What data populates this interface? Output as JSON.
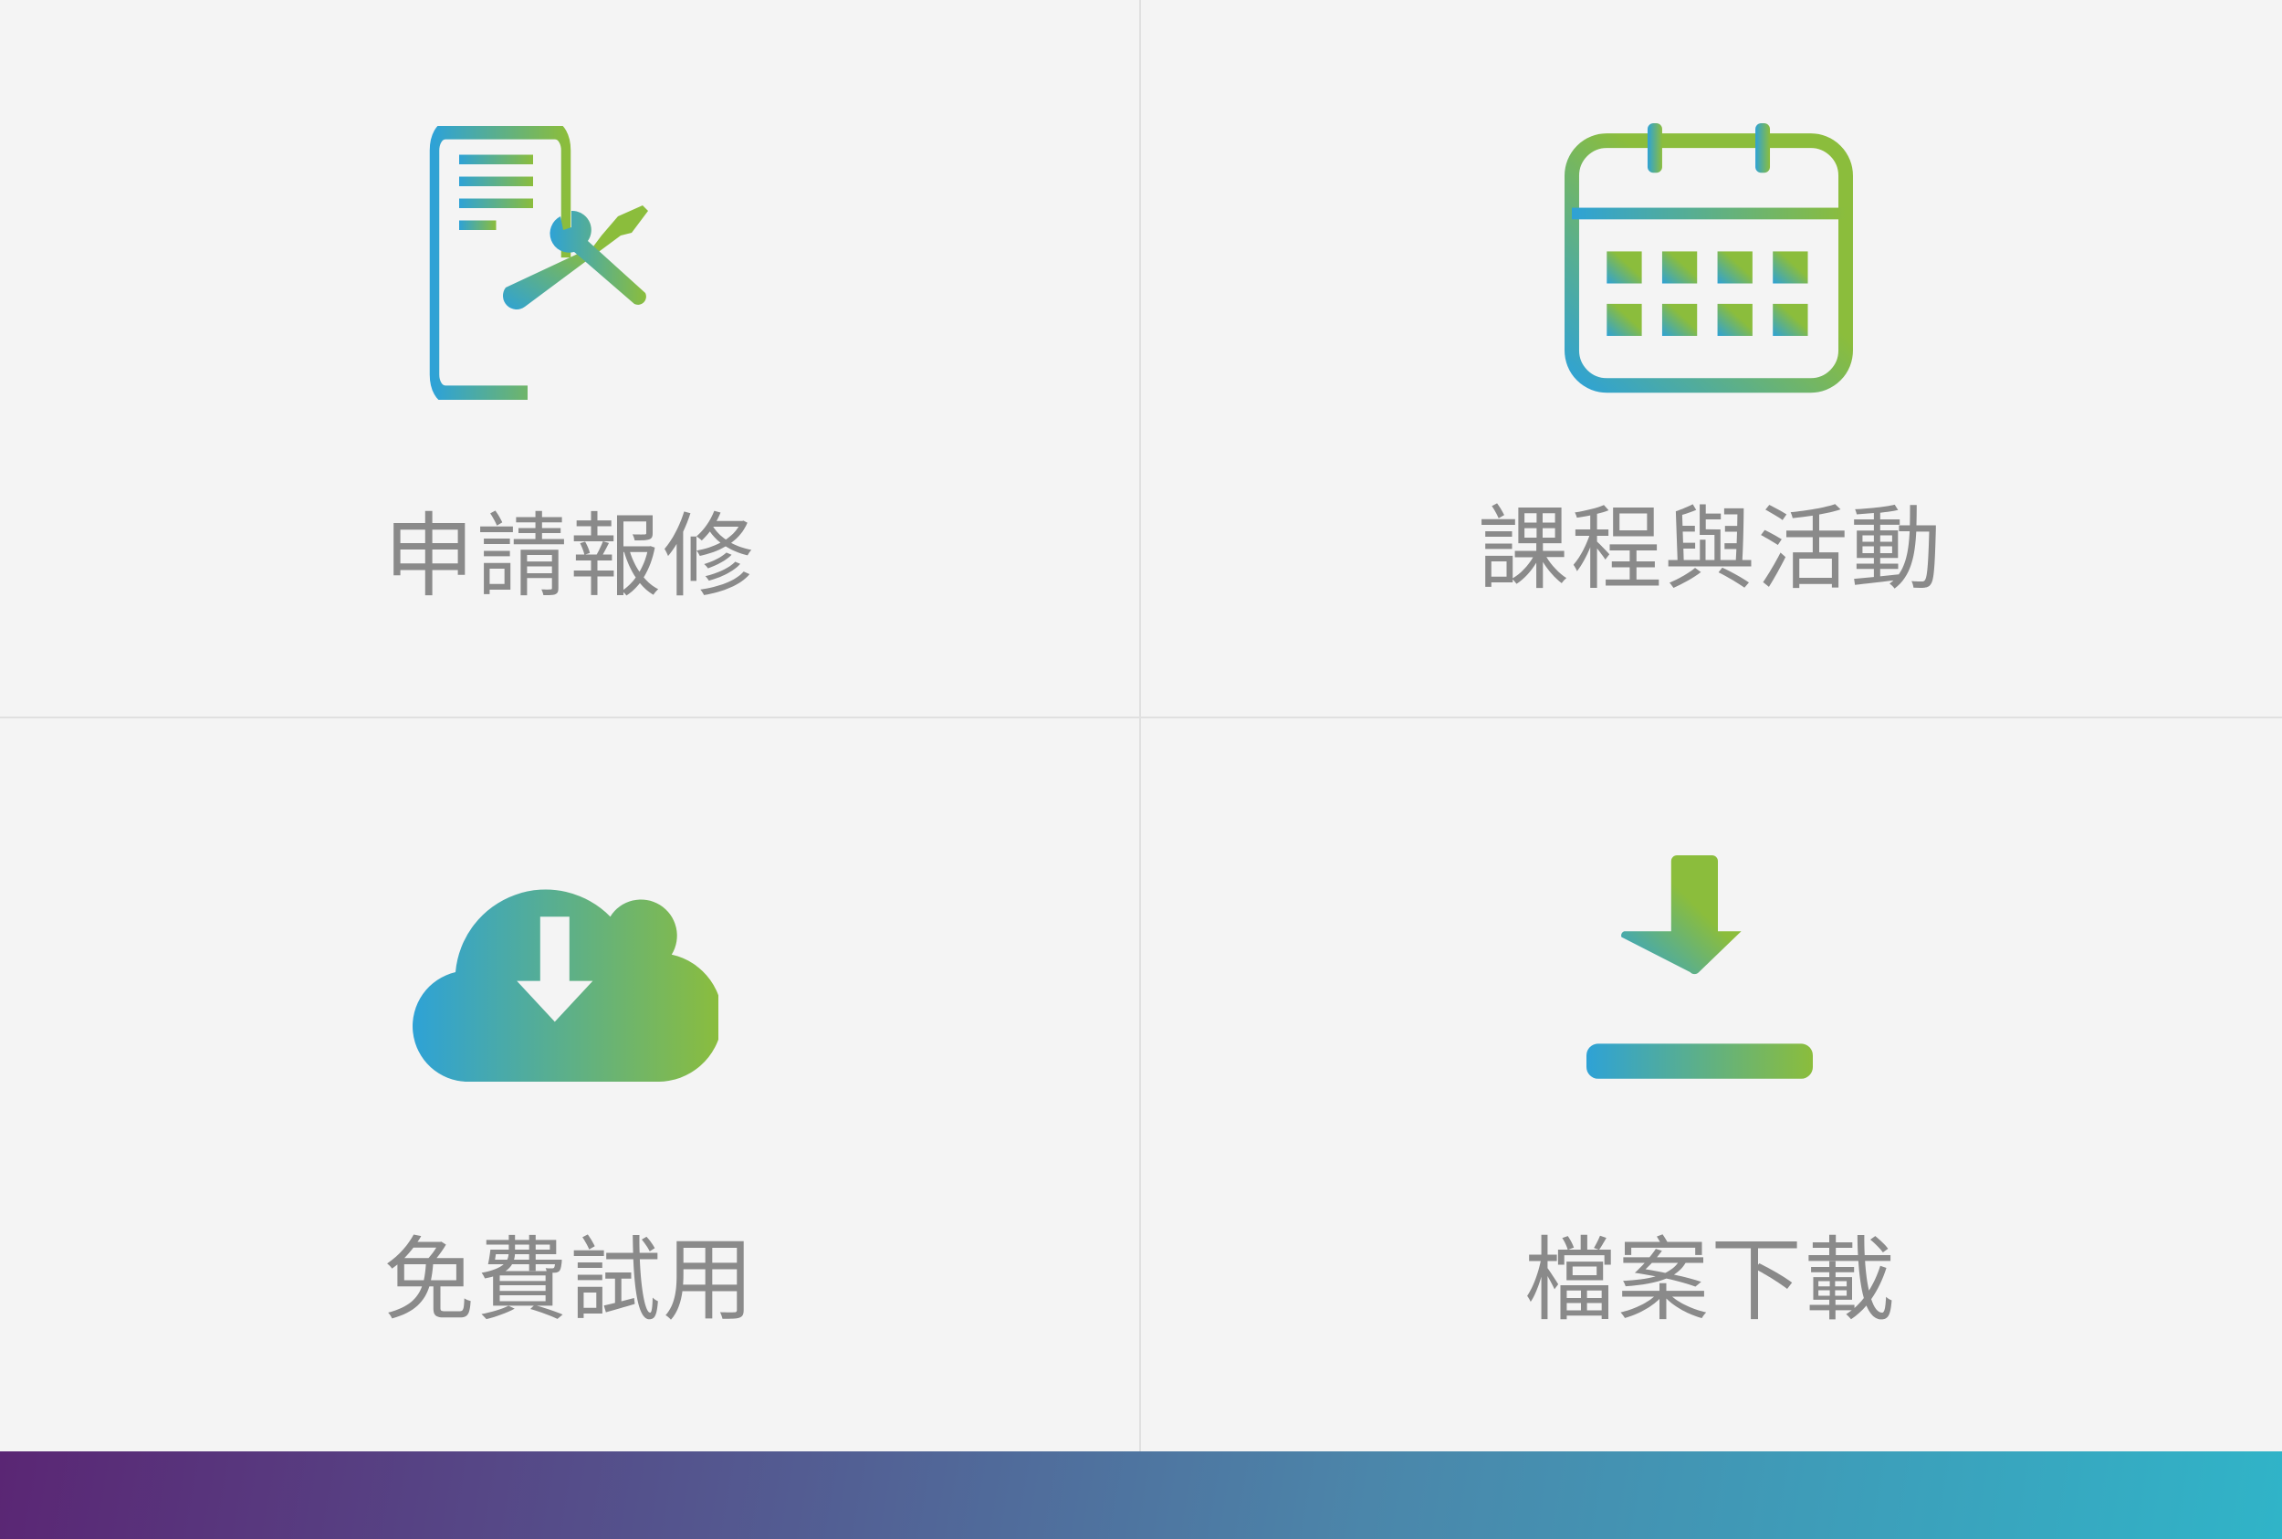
{
  "menu": [
    {
      "label": "申請報修",
      "icon": "repair-request-icon"
    },
    {
      "label": "課程與活動",
      "icon": "calendar-icon"
    },
    {
      "label": "免費試用",
      "icon": "cloud-download-icon"
    },
    {
      "label": "檔案下載",
      "icon": "download-icon"
    }
  ],
  "colors": {
    "gradient_start": "#2ea2d6",
    "gradient_end": "#8bbd3c",
    "label": "#8a8a8a",
    "footer_start": "#5a2674",
    "footer_end": "#30b4c8"
  }
}
